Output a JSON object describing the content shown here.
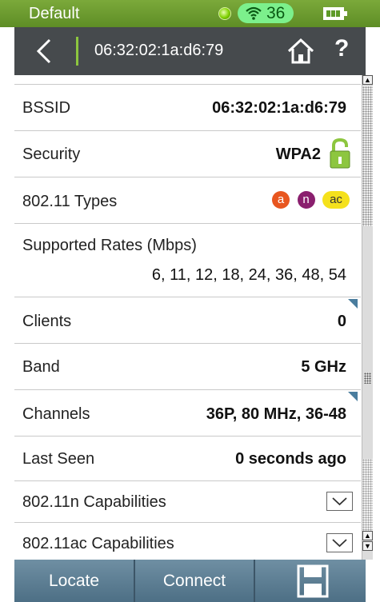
{
  "status_bar": {
    "title": "Default",
    "wifi_count": "36",
    "battery_level": 0.8,
    "colors": {
      "bar": "#6b9e30",
      "wifi_pill": "#7cf08c",
      "indicator": "#7fd000"
    }
  },
  "header": {
    "title": "06:32:02:1a:d6:79",
    "help_label": "?",
    "colors": {
      "bg": "#464a4d",
      "divider": "#8dc63f"
    }
  },
  "details": {
    "bssid": {
      "label": "BSSID",
      "value": "06:32:02:1a:d6:79"
    },
    "security": {
      "label": "Security",
      "value": "WPA2",
      "icon": "lock-icon"
    },
    "types": {
      "label": "802.11 Types",
      "chips": [
        {
          "text": "a",
          "color": "#e8561f",
          "text_color": "#ffffff"
        },
        {
          "text": "n",
          "color": "#8a1f6e",
          "text_color": "#ffffff"
        },
        {
          "text": "ac",
          "color": "#f5e11c",
          "text_color": "#333333"
        }
      ]
    },
    "rates": {
      "label": "Supported Rates (Mbps)",
      "value": "6, 11, 12, 18, 24, 36, 48, 54"
    },
    "clients": {
      "label": "Clients",
      "value": "0"
    },
    "band": {
      "label": "Band",
      "value": "5 GHz"
    },
    "channels": {
      "label": "Channels",
      "value": "36P, 80 MHz, 36-48"
    },
    "last_seen": {
      "label": "Last Seen",
      "value": "0 seconds ago"
    },
    "n_caps": {
      "label": "802.11n Capabilities",
      "icon": "chevron-down-icon"
    },
    "ac_caps": {
      "label": "802.11ac Capabilities",
      "icon": "chevron-down-icon"
    }
  },
  "bottom_bar": {
    "locate": "Locate",
    "connect": "Connect",
    "save_icon": "save-icon",
    "color": "#5a7b90"
  }
}
